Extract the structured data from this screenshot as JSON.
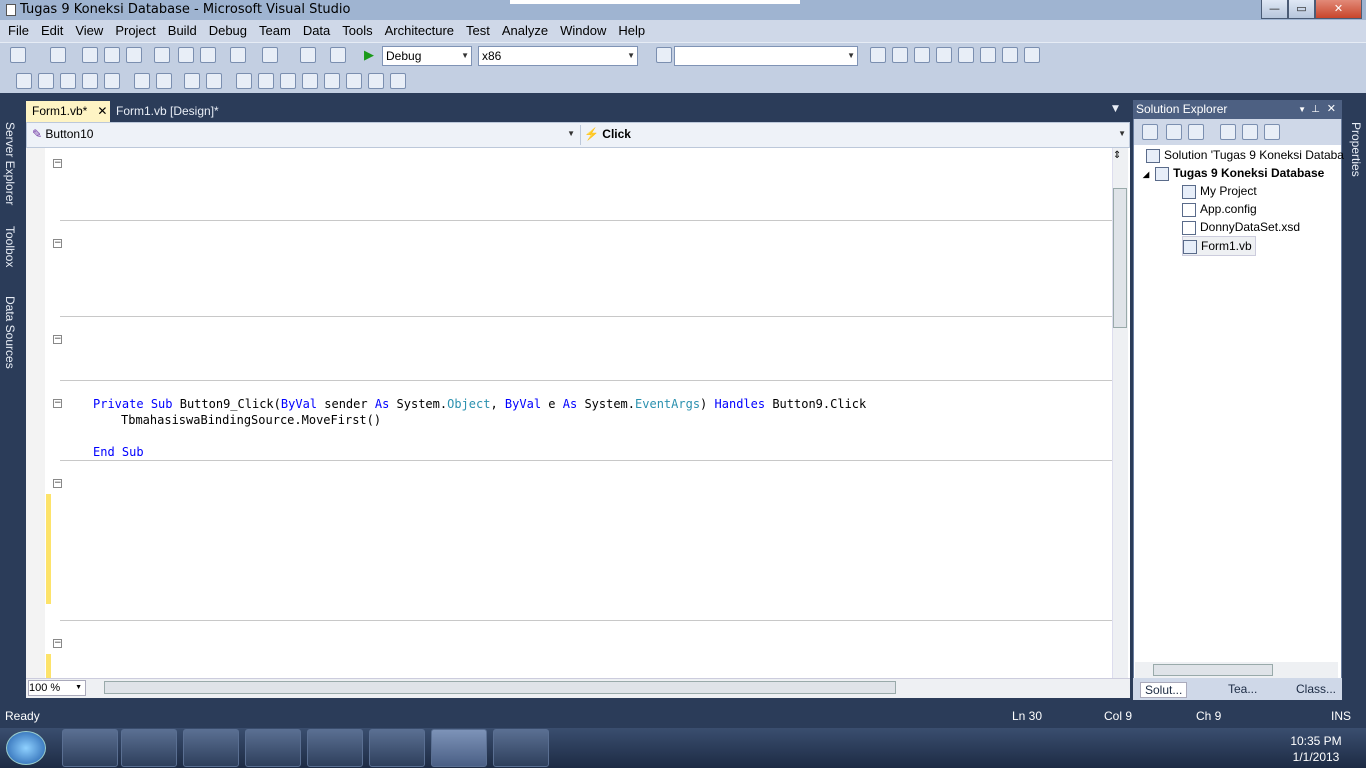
{
  "window": {
    "title": "Tugas 9 Koneksi Database - Microsoft Visual Studio"
  },
  "menu": [
    "File",
    "Edit",
    "View",
    "Project",
    "Build",
    "Debug",
    "Team",
    "Data",
    "Tools",
    "Architecture",
    "Test",
    "Analyze",
    "Window",
    "Help"
  ],
  "toolbar": {
    "config": "Debug",
    "platform": "x86",
    "find_value": ""
  },
  "tabs": {
    "active": "Form1.vb*",
    "design": "Form1.vb [Design]*"
  },
  "navbar": {
    "object": "Button10",
    "event": "Click"
  },
  "left_panels": [
    "Server Explorer",
    "Toolbox",
    "Data Sources"
  ],
  "right_panel": "Properties",
  "code": {
    "line1_private": "Private",
    "line1_sub": "Sub",
    "line1_name": "Button9_Click(",
    "line1_byval1": "ByVal",
    "line1_sender": "sender",
    "line1_as1": "As",
    "line1_sys1": "System.",
    "line1_object": "Object",
    "line1_comma": ", ",
    "line1_byval2": "ByVal",
    "line1_e": "e",
    "line1_as2": "As",
    "line1_sys2": "System.",
    "line1_eventargs": "EventArgs",
    "line1_paren": ")",
    "line1_handles": "Handles",
    "line1_handler": "Button9.Click",
    "line2": "TbmahasiswaBindingSource.MoveFirst()",
    "line3_end": "End",
    "line3_sub": "Sub"
  },
  "zoom": "100 %",
  "solution_explorer": {
    "title": "Solution Explorer",
    "solution": "Solution 'Tugas 9 Koneksi Databa",
    "project": "Tugas 9 Koneksi Database",
    "items": [
      "My Project",
      "App.config",
      "DonnyDataSet.xsd",
      "Form1.vb"
    ],
    "tabs": [
      "Solut...",
      "Tea...",
      "Class..."
    ]
  },
  "status": {
    "text": "Ready",
    "ln": "Ln 30",
    "col": "Col 9",
    "ch": "Ch 9",
    "mode": "INS"
  },
  "clock": {
    "time": "10:35 PM",
    "date": "1/1/2013"
  },
  "colors": {
    "keyword": "#0000ff",
    "type": "#2b91af",
    "chrome": "#2b3c59",
    "modified": "#fde36a"
  }
}
